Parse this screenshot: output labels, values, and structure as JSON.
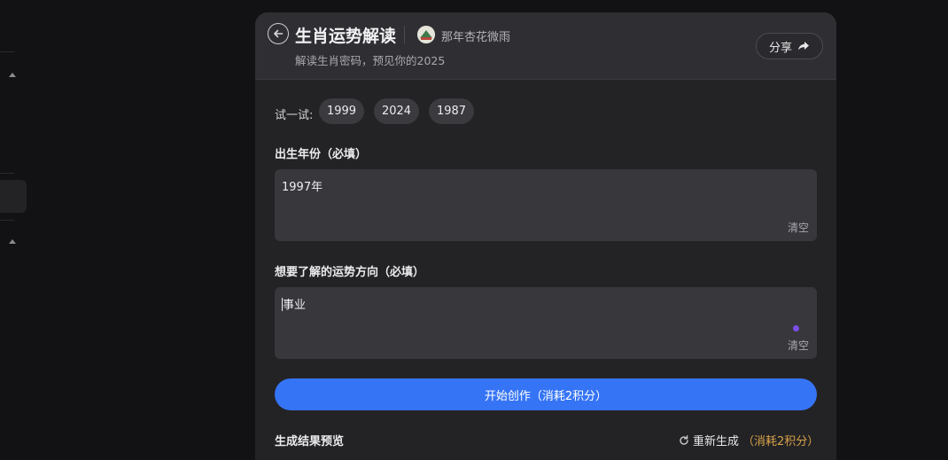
{
  "header": {
    "title": "生肖运势解读",
    "author": "那年杏花微雨",
    "subtitle": "解读生肖密码，预见你的2025",
    "share_label": "分享"
  },
  "try": {
    "label": "试一试:",
    "chips": [
      "1999",
      "2024",
      "1987"
    ]
  },
  "fields": {
    "birth_year": {
      "label": "出生年份（必填）",
      "value": "1997年",
      "clear": "清空"
    },
    "direction": {
      "label": "想要了解的运势方向（必填）",
      "value": "事业",
      "clear": "清空"
    }
  },
  "actions": {
    "start_label": "开始创作（消耗2积分）",
    "preview_label": "生成结果预览",
    "regen_label": "重新生成",
    "regen_cost": "（消耗2积分）"
  },
  "colors": {
    "accent": "#3574f5",
    "cost": "#d8a24a",
    "indicator": "#7b4fe8"
  },
  "icons": [
    "back-arrow-icon",
    "share-arrow-icon",
    "refresh-icon",
    "caret-up-icon"
  ]
}
